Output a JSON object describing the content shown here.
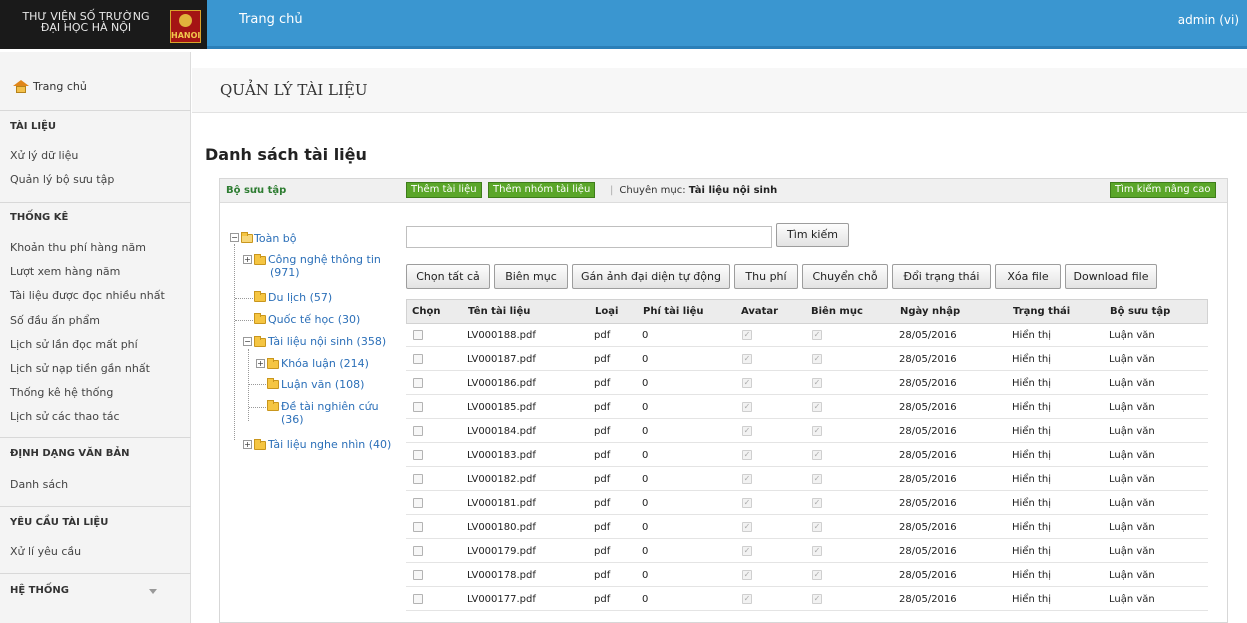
{
  "brand": {
    "line1": "THƯ VIỆN SỐ TRƯỜNG",
    "line2": "ĐẠI HỌC HÀ NỘI",
    "logo_text": "HANOI"
  },
  "topbar": {
    "home": "Trang chủ",
    "user": "admin (vi)"
  },
  "sidebar": {
    "home": "Trang chủ",
    "sections": [
      {
        "title": "TÀI LIỆU",
        "items": [
          "Xử lý dữ liệu",
          "Quản lý bộ sưu tập"
        ]
      },
      {
        "title": "THỐNG KÊ",
        "items": [
          "Khoản thu phí hàng năm",
          "Lượt xem hàng năm",
          "Tài liệu được đọc nhiều nhất",
          "Số đầu ấn phẩm",
          "Lịch sử lần đọc mất phí",
          "Lịch sử nạp tiền gần nhất",
          "Thống kê hệ thống",
          "Lịch sử các thao tác"
        ]
      },
      {
        "title": "ĐỊNH DẠNG VĂN BẢN",
        "items": [
          "Danh sách"
        ]
      },
      {
        "title": "YÊU CẦU TÀI LIỆU",
        "items": [
          "Xử lí yêu cầu"
        ]
      },
      {
        "title": "HỆ THỐNG",
        "items": []
      }
    ]
  },
  "page": {
    "title": "QUẢN LÝ TÀI LIỆU",
    "list_title": "Danh sách tài liệu"
  },
  "panel": {
    "collection_title": "Bộ sưu tập",
    "add_doc": "Thêm tài liệu",
    "add_group": "Thêm nhóm tài liệu",
    "category_prefix": "Chuyên mục:",
    "category": "Tài liệu nội sinh",
    "advanced_search": "Tìm kiếm nâng cao"
  },
  "tree": {
    "root": "Toàn bộ",
    "cntt": "Công nghệ thông tin",
    "cntt_count": "(971)",
    "dulich": "Du lịch (57)",
    "qth": "Quốc tế học (30)",
    "tlns": "Tài liệu nội sinh (358)",
    "khoaluan": "Khóa luận (214)",
    "luanvan": "Luận văn (108)",
    "detai": "Đề tài nghiên cứu",
    "detai_count": "(36)",
    "nghenhin": "Tài liệu nghe nhìn (40)"
  },
  "search": {
    "placeholder": "",
    "button": "Tìm kiếm"
  },
  "actions": [
    "Chọn tất cả",
    "Biên mục",
    "Gán ảnh đại diện tự động",
    "Thu phí",
    "Chuyển chỗ",
    "Đổi trạng thái",
    "Xóa file",
    "Download file"
  ],
  "table": {
    "headers": [
      "Chọn",
      "Tên tài liệu",
      "Loại",
      "Phí tài liệu",
      "Avatar",
      "Biên mục",
      "Ngày nhập",
      "Trạng thái",
      "Bộ sưu tập"
    ],
    "rows": [
      {
        "name": "LV000188.pdf",
        "type": "pdf",
        "fee": "0",
        "date": "28/05/2016",
        "status": "Hiển thị",
        "collection": "Luận văn"
      },
      {
        "name": "LV000187.pdf",
        "type": "pdf",
        "fee": "0",
        "date": "28/05/2016",
        "status": "Hiển thị",
        "collection": "Luận văn"
      },
      {
        "name": "LV000186.pdf",
        "type": "pdf",
        "fee": "0",
        "date": "28/05/2016",
        "status": "Hiển thị",
        "collection": "Luận văn"
      },
      {
        "name": "LV000185.pdf",
        "type": "pdf",
        "fee": "0",
        "date": "28/05/2016",
        "status": "Hiển thị",
        "collection": "Luận văn"
      },
      {
        "name": "LV000184.pdf",
        "type": "pdf",
        "fee": "0",
        "date": "28/05/2016",
        "status": "Hiển thị",
        "collection": "Luận văn"
      },
      {
        "name": "LV000183.pdf",
        "type": "pdf",
        "fee": "0",
        "date": "28/05/2016",
        "status": "Hiển thị",
        "collection": "Luận văn"
      },
      {
        "name": "LV000182.pdf",
        "type": "pdf",
        "fee": "0",
        "date": "28/05/2016",
        "status": "Hiển thị",
        "collection": "Luận văn"
      },
      {
        "name": "LV000181.pdf",
        "type": "pdf",
        "fee": "0",
        "date": "28/05/2016",
        "status": "Hiển thị",
        "collection": "Luận văn"
      },
      {
        "name": "LV000180.pdf",
        "type": "pdf",
        "fee": "0",
        "date": "28/05/2016",
        "status": "Hiển thị",
        "collection": "Luận văn"
      },
      {
        "name": "LV000179.pdf",
        "type": "pdf",
        "fee": "0",
        "date": "28/05/2016",
        "status": "Hiển thị",
        "collection": "Luận văn"
      },
      {
        "name": "LV000178.pdf",
        "type": "pdf",
        "fee": "0",
        "date": "28/05/2016",
        "status": "Hiển thị",
        "collection": "Luận văn"
      },
      {
        "name": "LV000177.pdf",
        "type": "pdf",
        "fee": "0",
        "date": "28/05/2016",
        "status": "Hiển thị",
        "collection": "Luận văn"
      }
    ]
  }
}
